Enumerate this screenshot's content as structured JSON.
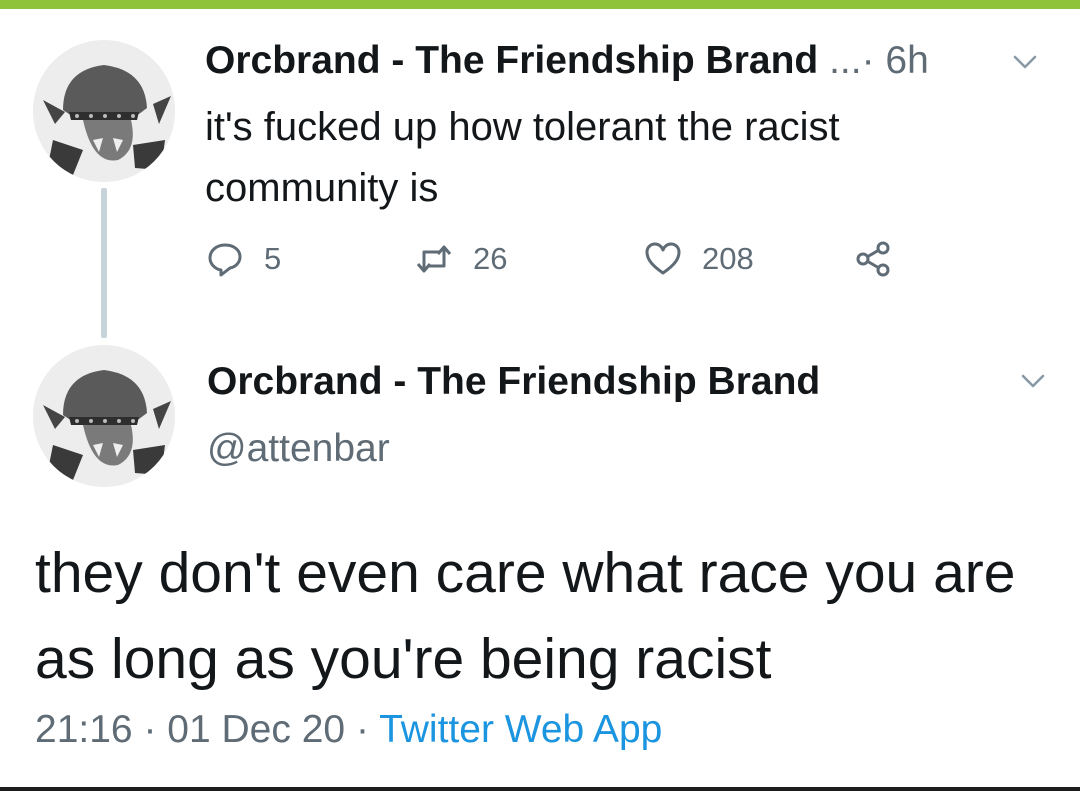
{
  "tweet1": {
    "author_name": "Orcbrand - The Friendship Brand",
    "ellipsis": "...·",
    "time": "6h",
    "text": "it's fucked up how tolerant the racist community is",
    "replies": "5",
    "retweets": "26",
    "likes": "208"
  },
  "tweet2": {
    "author_name": "Orcbrand - The Friendship Brand",
    "handle": "@attenbar",
    "text": "they don't even care what race you are as long as you're being racist",
    "time": "21:16",
    "date": "01 Dec 20",
    "separator": "·",
    "source": "Twitter Web App"
  },
  "colors": {
    "accent_bar": "#8fc33a",
    "link": "#1b95e0",
    "muted": "#5f6b75",
    "thread_line": "#c9d3da"
  },
  "icons": {
    "reply": "reply-icon",
    "retweet": "retweet-icon",
    "like": "heart-icon",
    "share": "share-icon",
    "caret": "chevron-down-icon"
  }
}
